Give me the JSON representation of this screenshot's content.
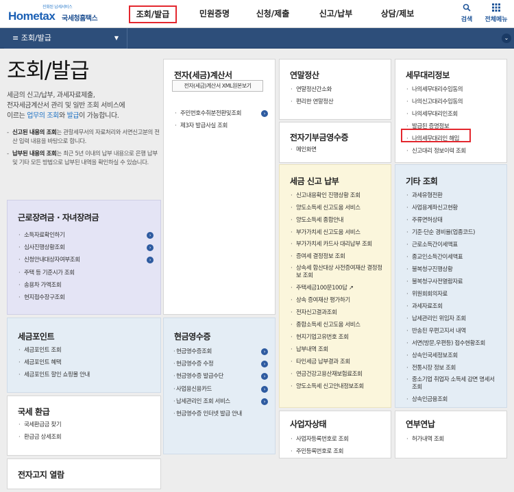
{
  "header": {
    "logo_small": "진화된 납세서비스",
    "logo_brand": "Hometax",
    "logo_korean": "국세청홈택스",
    "nav": [
      {
        "label": "조회/발급",
        "active": true
      },
      {
        "label": "민원증명"
      },
      {
        "label": "신청/제출"
      },
      {
        "label": "신고/납부"
      },
      {
        "label": "상담/제보"
      }
    ],
    "search_label": "검색",
    "allmenu_label": "전체메뉴"
  },
  "subbar": {
    "menu_label": "조회/발급"
  },
  "intro": {
    "title": "조회/발급",
    "desc_1": "세금의 신고/납부, 과세자료제출,",
    "desc_2": "전자세금계산서 관리 및 일반 조회 서비스에",
    "desc_3a": "이르는 ",
    "desc_3b": "업무의 조회",
    "desc_3c": "와 ",
    "desc_3d": "발급",
    "desc_3e": "이 가능합니다.",
    "note1_bold": "신고된 내용의 조회",
    "note1_rest": "는 관할세무서의 자료처리와 서면신고분의 전산 입력 내용을 바탕으로 합니다.",
    "note2_bold": "납부된 내용의 조회",
    "note2_rest": "는 최근 5년 이내의 납부 내용으로 은행 납부 및 기타 모든 방법으로 납부된 내역을 확인하실 수 있습니다."
  },
  "boxes": {
    "etax": {
      "title": "전자(세금)계산서",
      "button": "전자(세금)계산서 XML원본보기",
      "items": [
        "주민번호수취분전환및조회",
        "제3자 발급사실 조회"
      ]
    },
    "yearend": {
      "title": "연말정산",
      "items": [
        "연말정산간소화",
        "편리한 연말정산"
      ]
    },
    "agent": {
      "title": "세무대리정보",
      "items": [
        "나의세무대리수임동의",
        "나의신고대리수임동의",
        "나의세무대리인조회",
        "발급된 증명정보",
        "나의세무대리인 해임",
        "신고대리 정보이력 조회"
      ]
    },
    "edonation": {
      "title": "전자기부금영수증",
      "items": [
        "메인화면"
      ]
    },
    "taxreport": {
      "title": "세금 신고 납부",
      "items": [
        "신고내용확인 진행상황 조회",
        "양도소득세 신고도움 서비스",
        "양도소득세 종합안내",
        "부가가치세 신고도움 서비스",
        "부가가치세 카드사 대리납부 조회",
        "증여세 결정정보 조회",
        "상속세 합산대상 사전증여재산 결정정보 조회",
        "주택세금100문100답",
        "상속 증여재산 평가하기",
        "전자신고결과조회",
        "종합소득세 신고도움 서비스",
        "현지기업고유번호 조회",
        "납부내역 조회",
        "타인세금 납부결과 조회",
        "연금건강고용산재보험료조회",
        "양도소득세 신고안내정보조회"
      ]
    },
    "etc": {
      "title": "기타 조회",
      "items": [
        "과세유형전환",
        "사업용계좌신고현황",
        "주류면허상태",
        "기준·단순 경비율(업종코드)",
        "근로소득간이세액표",
        "종교인소득간이세액표",
        "불복청구진행상황",
        "불복청구사전열람자료",
        "위원회회의자료",
        "과세자료조회",
        "납세관리인 위임자 조회",
        "반송된 우편고지서 내역",
        "서면(방문,우편등) 접수현황조회",
        "상속인국세정보조회",
        "전통시장 정보 조회",
        "중소기업 취업자 소득세 감면 명세서 조회",
        "상속인금융조회"
      ]
    },
    "earned": {
      "title": "근로장려금 · 자녀장려금",
      "items": [
        "소득자료확인하기",
        "심사진행상황조회",
        "신청안내대상자여부조회",
        "주택 등 기준시가 조회",
        "송용차 가액조회",
        "현지접수장구조회"
      ]
    },
    "points": {
      "title": "세금포인트",
      "items": [
        "세금포인트 조회",
        "세금포인트 혜택",
        "세금포인트 할인 쇼핑몰 안내"
      ]
    },
    "cash": {
      "title": "현금영수증",
      "items": [
        "현금영수증조회",
        "현금영수증 수정",
        "현금영수증 발급수단",
        "사업용신용카드",
        "납세관리인 조회 서비스",
        "현금영수증 인터넷 발급 안내"
      ]
    },
    "refund": {
      "title": "국세 환급",
      "items": [
        "국세환급금 찾기",
        "환급금 상세조회"
      ]
    },
    "business": {
      "title": "사업자상태",
      "items": [
        "사업자등록번호로 조회",
        "주민등록번호로 조회"
      ]
    },
    "pension": {
      "title": "연부연납",
      "items": [
        "허가내역 조회"
      ]
    },
    "ebill": {
      "title": "전자고지 열람"
    }
  }
}
